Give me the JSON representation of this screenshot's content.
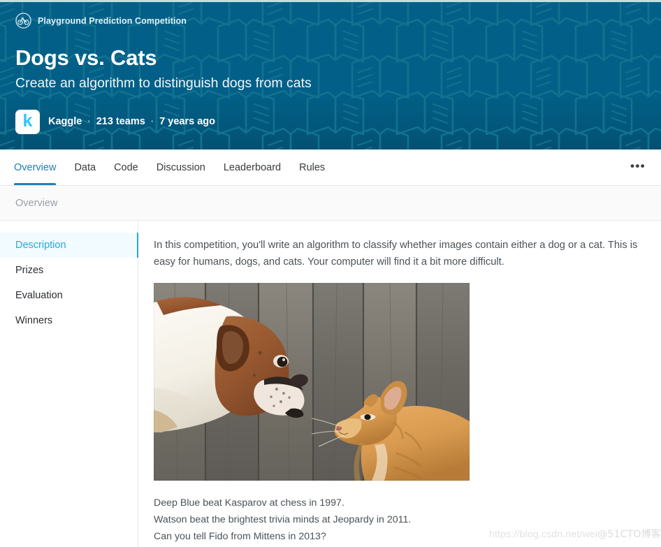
{
  "hero": {
    "kicker": "Playground Prediction Competition",
    "kicker_icon": "bicycle-icon",
    "title": "Dogs vs. Cats",
    "subtitle": "Create an algorithm to distinguish dogs from cats",
    "avatar_letter": "k",
    "organizer": "Kaggle",
    "teams": "213 teams",
    "age": "7 years ago",
    "separator": "·",
    "bg_color": "#026088",
    "title_color": "#ffffff",
    "avatar_bg": "#ffffff",
    "avatar_letter_color": "#32c5ff"
  },
  "tabs": {
    "items": [
      {
        "label": "Overview",
        "active": true
      },
      {
        "label": "Data",
        "active": false
      },
      {
        "label": "Code",
        "active": false
      },
      {
        "label": "Discussion",
        "active": false
      },
      {
        "label": "Leaderboard",
        "active": false
      },
      {
        "label": "Rules",
        "active": false
      }
    ],
    "more_label": "•••",
    "more_icon": "ellipsis-icon",
    "active_color": "#2080b8"
  },
  "breadcrumb": {
    "text": "Overview"
  },
  "sidebar": {
    "items": [
      {
        "label": "Description",
        "active": true
      },
      {
        "label": "Prizes",
        "active": false
      },
      {
        "label": "Evaluation",
        "active": false
      },
      {
        "label": "Winners",
        "active": false
      }
    ],
    "active_color": "#23a9e0",
    "active_bg": "#f2fbff"
  },
  "main": {
    "intro": "In this competition, you'll write an algorithm to classify whether images contain either a dog or a cat.  This is easy for humans, dogs, and cats. Your computer will find it a bit more difficult.",
    "image_alt": "dog-and-cat-facing-each-other-photo",
    "caption_lines": [
      "Deep Blue beat Kasparov at chess in 1997.",
      "Watson beat the brightest trivia minds at Jeopardy in 2011.",
      "Can you tell Fido from Mittens in 2013?"
    ]
  },
  "watermark": {
    "url_text": "https://blog.csdn.net/wei",
    "overlay_text": "@51CTO博客"
  }
}
